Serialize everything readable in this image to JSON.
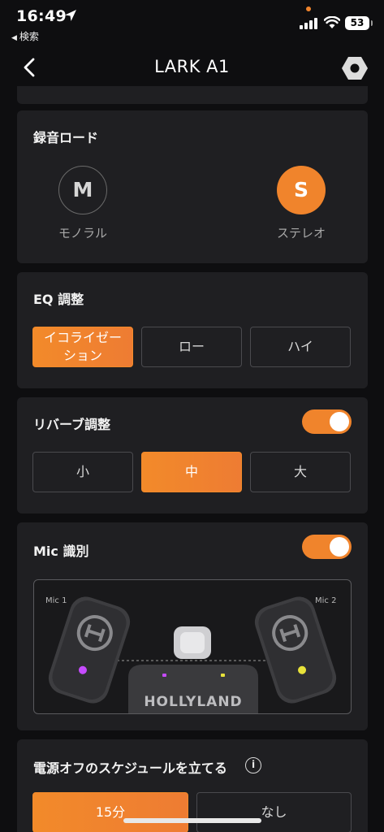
{
  "status_bar": {
    "time": "16:49",
    "back_app": "検索",
    "battery": "53",
    "location_icon": "location-arrow-icon",
    "signal_icon": "cellular-signal-icon",
    "wifi_icon": "wifi-icon"
  },
  "nav": {
    "title": "LARK A1",
    "back_icon": "chevron-left-icon",
    "settings_icon": "hexagon-settings-icon"
  },
  "recording_mode": {
    "title": "録音ロード",
    "mono_letter": "M",
    "mono_label": "モノラル",
    "stereo_letter": "S",
    "stereo_label": "ステレオ",
    "selected": "stereo"
  },
  "eq": {
    "title": "EQ 調整",
    "options": [
      "イコライゼーション",
      "ロー",
      "ハイ"
    ],
    "option_1_line1": "イコライゼー",
    "option_1_line2": "ション",
    "selected_index": 0
  },
  "reverb": {
    "title": "リバーブ調整",
    "enabled": true,
    "options": [
      "小",
      "中",
      "大"
    ],
    "selected_index": 1
  },
  "mic_id": {
    "title": "Mic 識別",
    "enabled": true,
    "mic1_label": "Mic 1",
    "mic2_label": "Mic 2",
    "receiver_brand": "HOLLYLAND",
    "mic1_led_color": "#c64bff",
    "mic2_led_color": "#e8e23a"
  },
  "power_off": {
    "title": "電源オフのスケジュールを立てる",
    "info_glyph": "i",
    "options": [
      "15分",
      "なし"
    ],
    "selected_index": 0
  },
  "colors": {
    "accent": "#f0842c",
    "card": "#1f1f22",
    "background": "#0e0e10"
  }
}
